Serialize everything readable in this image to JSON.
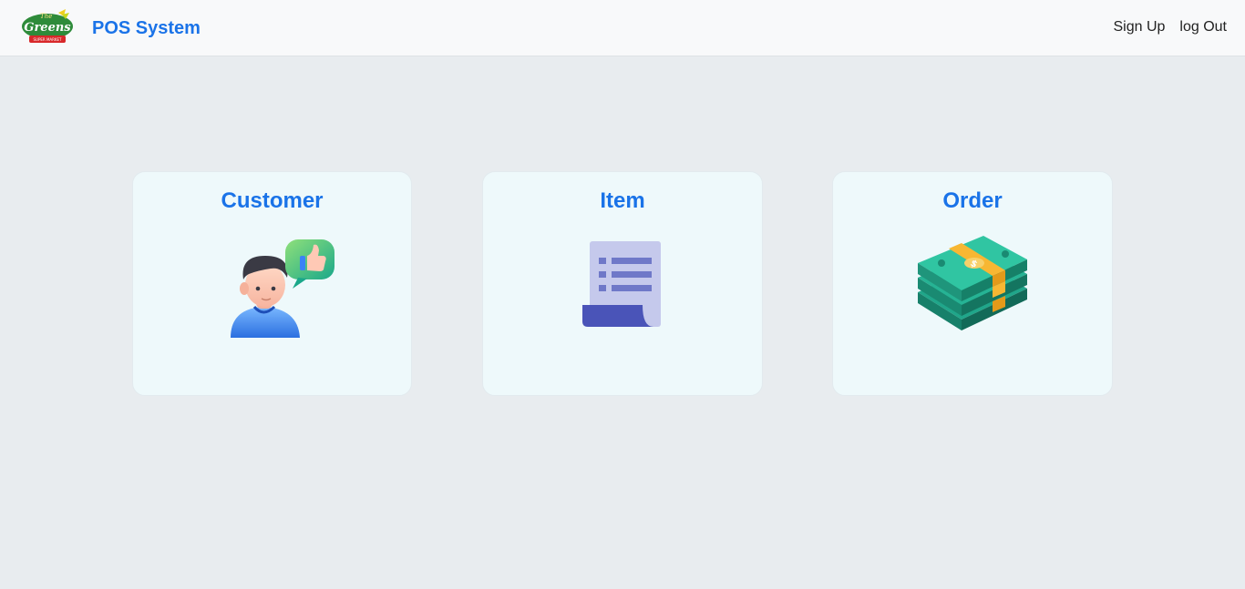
{
  "header": {
    "brand": "POS System",
    "logo": {
      "top_text": "The",
      "main_text": "Greens",
      "sub_text": "SUPER MARKET"
    },
    "nav": [
      {
        "label": "Sign Up"
      },
      {
        "label": "log Out"
      }
    ]
  },
  "cards": [
    {
      "title": "Customer",
      "icon": "customer-thumbs-up-icon"
    },
    {
      "title": "Item",
      "icon": "document-list-icon"
    },
    {
      "title": "Order",
      "icon": "money-stack-icon"
    }
  ],
  "colors": {
    "accent": "#1a73e8",
    "background": "#e8ecef",
    "navbar": "#f8f9fa",
    "card": "#eef9fb"
  }
}
